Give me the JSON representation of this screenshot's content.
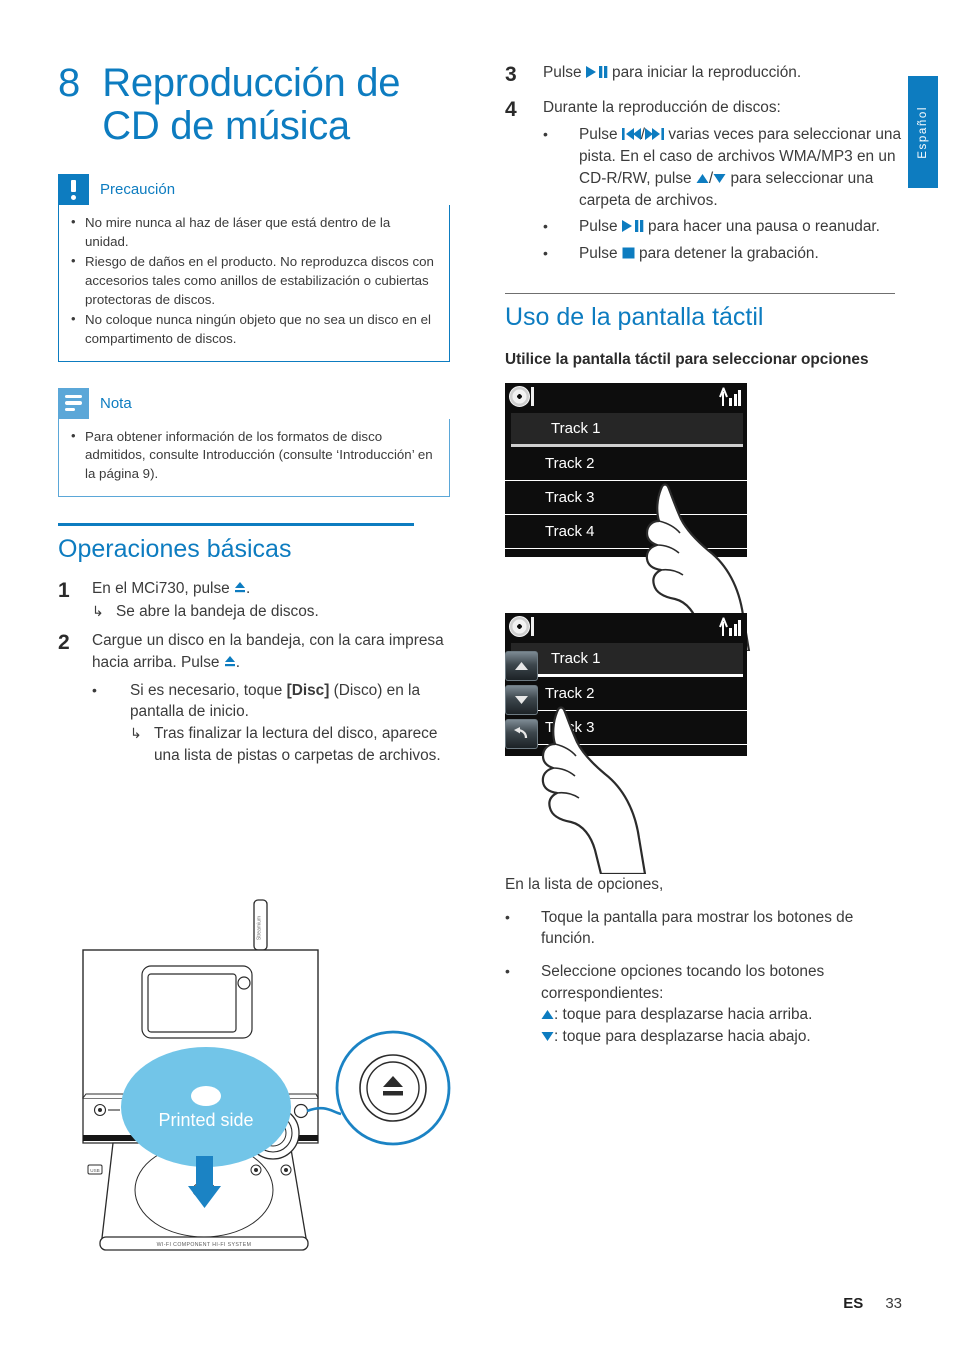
{
  "language_tab": "Español",
  "chapter": {
    "number": "8",
    "title": "Reproducción de CD de música"
  },
  "caution": {
    "label": "Precaución",
    "icon": "exclamation-icon",
    "color": "#0d7cc0",
    "items": [
      "No mire nunca al haz de láser que está dentro de la unidad.",
      "Riesgo de daños en el producto. No reproduzca discos con accesorios tales como anillos de estabilización o cubiertas protectoras de discos.",
      "No coloque nunca ningún objeto que no sea un disco en el compartimento de discos."
    ]
  },
  "note": {
    "label": "Nota",
    "icon": "note-lines-icon",
    "color": "#5ba7d8",
    "items": [
      "Para obtener información de los formatos de disco admitidos, consulte Introducción (consulte ‘Introducción’ en la página 9)."
    ]
  },
  "basic_ops": {
    "heading": "Operaciones básicas",
    "step1": {
      "num": "1",
      "text_before": "En el MCi730, pulse ",
      "icon": "eject-icon",
      "text_after": ".",
      "result_arrow": "↳",
      "result": "Se abre la bandeja de discos."
    },
    "step2": {
      "num": "2",
      "text_before": "Cargue un disco en la bandeja, con la cara impresa hacia arriba. Pulse ",
      "icon": "eject-icon",
      "text_after": ".",
      "bullet_before": "Si es necesario, toque ",
      "bullet_bold": "[Disc]",
      "bullet_after": " (Disco) en la pantalla de inicio.",
      "result_arrow": "↳",
      "result": "Tras finalizar la lectura del disco, aparece una lista de pistas o carpetas de archivos."
    }
  },
  "playback": {
    "step3": {
      "num": "3",
      "text_before": "Pulse ",
      "icon": "play-pause-icon",
      "text_after": " para iniciar la reproducción."
    },
    "step4": {
      "num": "4",
      "text": "Durante la reproducción de discos:",
      "bullets": [
        {
          "before": "Pulse ",
          "icon1": "previous-icon",
          "sep": "/",
          "icon2": "next-icon",
          "mid": " varias veces para seleccionar una pista. En el caso de archivos WMA/MP3 en un CD-R/RW, pulse ",
          "icon3": "up-arrow-icon",
          "sep2": "/",
          "icon4": "down-arrow-icon",
          "after": " para seleccionar una carpeta de archivos."
        },
        {
          "before": "Pulse ",
          "icon1": "play-pause-icon",
          "after": " para hacer una pausa o reanudar."
        },
        {
          "before": "Pulse ",
          "icon1": "stop-icon",
          "after": " para detener la grabación."
        }
      ]
    }
  },
  "touchscreen": {
    "heading": "Uso de la pantalla táctil",
    "intro": "Utilice la pantalla táctil para seleccionar opciones",
    "screen_one": {
      "status_icons": [
        "disc-icon",
        "wifi-signal-icon"
      ],
      "tracks": [
        "Track 1",
        "Track 2",
        "Track 3",
        "Track 4"
      ],
      "selected": "Track 1"
    },
    "screen_two": {
      "status_icons": [
        "disc-icon",
        "wifi-signal-icon"
      ],
      "tracks": [
        "Track 1",
        "Track 2",
        "Track 3"
      ],
      "selected": "Track 1",
      "function_buttons": [
        "scroll-up-button",
        "scroll-down-button",
        "back-button"
      ]
    },
    "list_intro": "En la lista de opciones,",
    "bullets": [
      "Toque la pantalla para mostrar los botones de función.",
      "Seleccione opciones tocando los botones correspondientes:"
    ],
    "sub_up_icon": "up-arrow-icon",
    "sub_up": ": toque para desplazarse hacia arriba.",
    "sub_down_icon": "down-arrow-icon",
    "sub_down": ": toque para desplazarse hacia abajo."
  },
  "device_illustration": {
    "disc_label": "Printed side",
    "antenna_label": "Streamium",
    "product_label": "WI-FI COMPONENT HI-FI SYSTEM",
    "callout_icon": "eject-button-icon",
    "disc_color": "#72c5e8",
    "arrow_color": "#1b83c4"
  },
  "footer": {
    "locale": "ES",
    "page": "33"
  }
}
